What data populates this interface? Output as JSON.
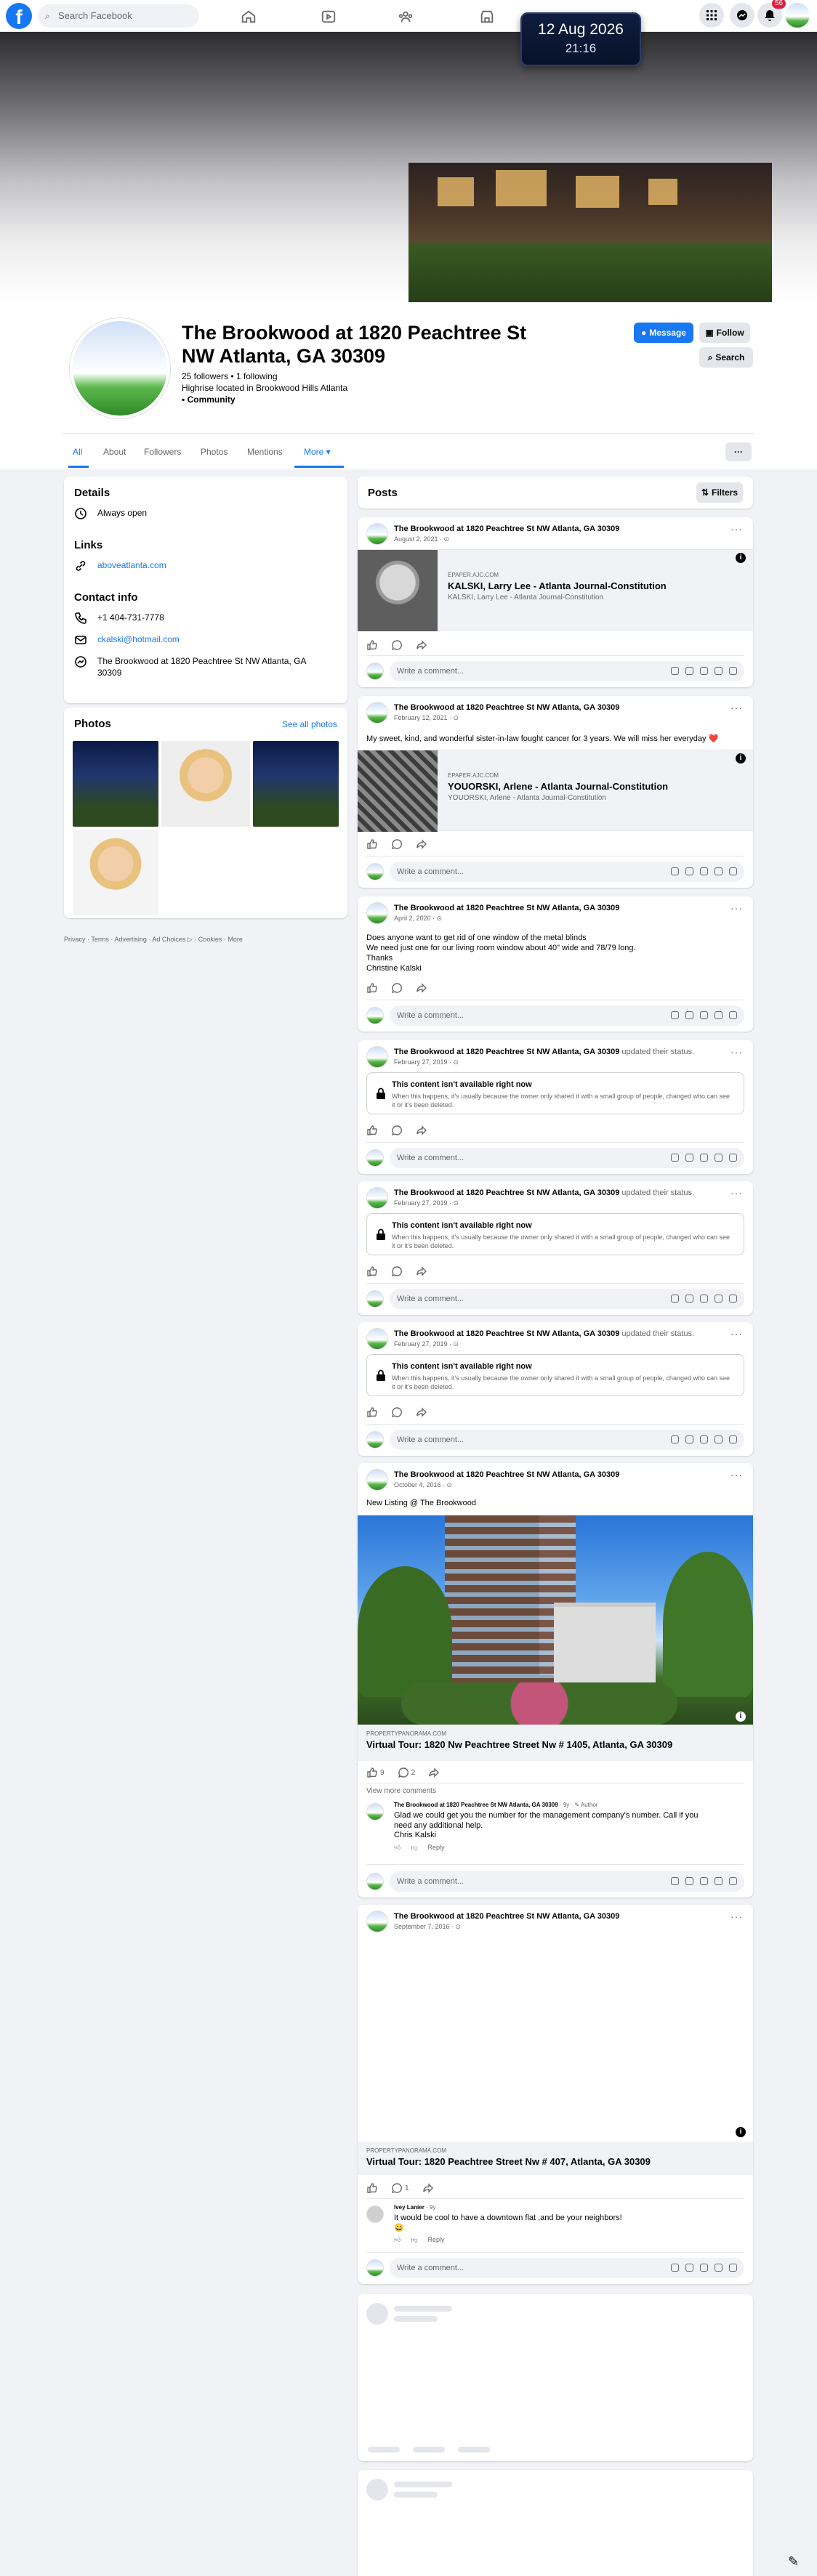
{
  "topbar": {
    "search_placeholder": "Search Facebook",
    "notif_count": "56"
  },
  "clock": {
    "date": "12 Aug 2026",
    "time": "21:16"
  },
  "profile": {
    "name": "The Brookwood at 1820 Peachtree St NW Atlanta, GA 30309",
    "followers": "25 followers • 1 following",
    "description": "Highrise located in Brookwood Hills Atlanta",
    "category": "Community",
    "message_label": "Message",
    "follow_label": "Follow",
    "search_label": "Search"
  },
  "tabs": [
    "All",
    "About",
    "Followers",
    "Photos",
    "Mentions",
    "More ▾"
  ],
  "details": {
    "title": "Details",
    "hours": "Always open",
    "links_title": "Links",
    "website": "aboveatlanta.com",
    "contact_title": "Contact info",
    "phone": "+1 404-731-7778",
    "email": "ckalski@hotmail.com",
    "address": "The Brookwood at 1820 Peachtree St NW Atlanta, GA 30309"
  },
  "photos": {
    "title": "Photos",
    "see_all": "See all photos"
  },
  "footer": "Privacy · Terms · Advertising · Ad Choices ▷ · Cookies · More",
  "posts_header": {
    "title": "Posts",
    "filters": "Filters"
  },
  "author": "The Brookwood at 1820 Peachtree St NW Atlanta, GA 30309",
  "comment_placeholder": "Write a comment...",
  "posts": [
    {
      "date": "August 2, 2021 · ⊙",
      "link_source": "EPAPER.AJC.COM",
      "link_title": "KALSKI, Larry Lee - Atlanta Journal-Constitution",
      "link_sub": "KALSKI, Larry Lee - Atlanta Journal-Constitution"
    },
    {
      "date": "February 12, 2021 · ⊙",
      "text": "My sweet, kind, and wonderful sister-in-law fought cancer for 3 years. We will miss her everyday ❤️",
      "link_source": "EPAPER.AJC.COM",
      "link_title": "YOUORSKI, Arlene - Atlanta Journal-Constitution",
      "link_sub": "YOUORSKI, Arlene - Atlanta Journal-Constitution"
    },
    {
      "date": "April 2, 2020 · ⊙",
      "lines": [
        "Does anyone want to get rid of one window of the metal blinds",
        "We need just one for our living room window about 40\" wide and 78/79 long.",
        "Thanks",
        "Christine Kalski"
      ]
    },
    {
      "date": "February 27, 2019 · ⊙",
      "suffix": "updated their status."
    },
    {
      "date": "February 27, 2019 · ⊙",
      "suffix": "updated their status."
    },
    {
      "date": "February 27, 2019 · ⊙",
      "suffix": "updated their status."
    },
    {
      "date": "October 4, 2016 · ⊙",
      "text": "New Listing @ The Brookwood",
      "link_source": "PROPERTYPANORAMA.COM",
      "link_title": "Virtual Tour: 1820 Nw Peachtree Street Nw # 1405, Atlanta, GA 30309",
      "likes": "9",
      "comments": "2",
      "view_more": "View more comments",
      "reply_name": "The Brookwood at 1820 Peachtree St NW Atlanta, GA 30309",
      "reply_meta": "· 9y · ✎ Author",
      "reply_text": "Glad we could get you the number for the management company's number. Call if you need any additional help.",
      "reply_sign": "Chris Kalski",
      "reply_label": "Reply"
    },
    {
      "date": "September 7, 2016 · ⊙",
      "link_source": "PROPERTYPANORAMA.COM",
      "link_title": "Virtual Tour: 1820 Peachtree Street Nw # 407, Atlanta, GA 30309",
      "comments": "1",
      "reply_name": "Ivey Lanier",
      "reply_meta": "· 9y",
      "reply_text": "It would be cool to have a downtown flat ,and be your neighbors!",
      "reply_emoji": "😀",
      "reply_label": "Reply"
    }
  ],
  "unavailable": {
    "title": "This content isn't available right now",
    "desc": "When this happens, it's usually because the owner only shared it with a small group of people, changed who can see it or it's been deleted."
  },
  "icons": [
    "facebook-logo",
    "search-icon",
    "home-icon",
    "video-icon",
    "groups-icon",
    "marketplace-icon",
    "gaming-icon",
    "menu-grid-icon",
    "messenger-icon",
    "bell-icon",
    "like-icon",
    "comment-icon",
    "share-icon",
    "lock-icon",
    "info-icon",
    "clock-icon",
    "link-icon",
    "phone-icon",
    "mail-icon"
  ]
}
